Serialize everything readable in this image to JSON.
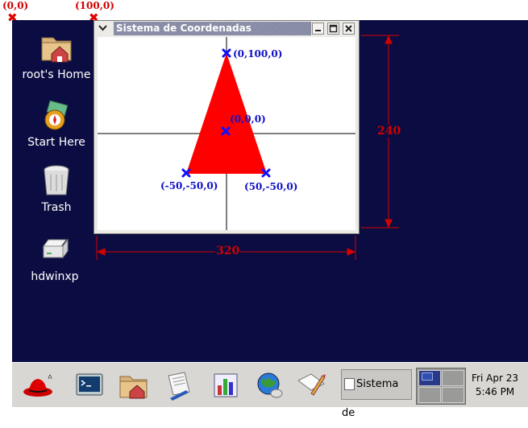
{
  "annotations": {
    "origin_label": "(0,0)",
    "x100_label": "(100,0)",
    "height_label": "240",
    "width_label": "320"
  },
  "desktop_icons": [
    {
      "label": "root's Home",
      "icon": "home-folder-icon"
    },
    {
      "label": "Start Here",
      "icon": "start-here-icon"
    },
    {
      "label": "Trash",
      "icon": "trash-icon"
    },
    {
      "label": "hdwinxp",
      "icon": "drive-icon"
    }
  ],
  "window": {
    "title": "Sistema de Coordenadas",
    "points": [
      {
        "label": "(0,100,0)"
      },
      {
        "label": "(0,0,0)"
      },
      {
        "label": "(-50,-50,0)"
      },
      {
        "label": "(50,-50,0)"
      }
    ],
    "triangle_color": "#ff0000",
    "point_color": "#1010ff"
  },
  "taskbar": {
    "launchers": [
      "redhat-menu-icon",
      "terminal-icon",
      "home-folder-icon",
      "text-editor-icon",
      "chart-icon",
      "browser-icon",
      "notepad-icon"
    ],
    "task_label": "Sistema de",
    "clock_date": "Fri Apr 23",
    "clock_time": "5:46 PM"
  }
}
